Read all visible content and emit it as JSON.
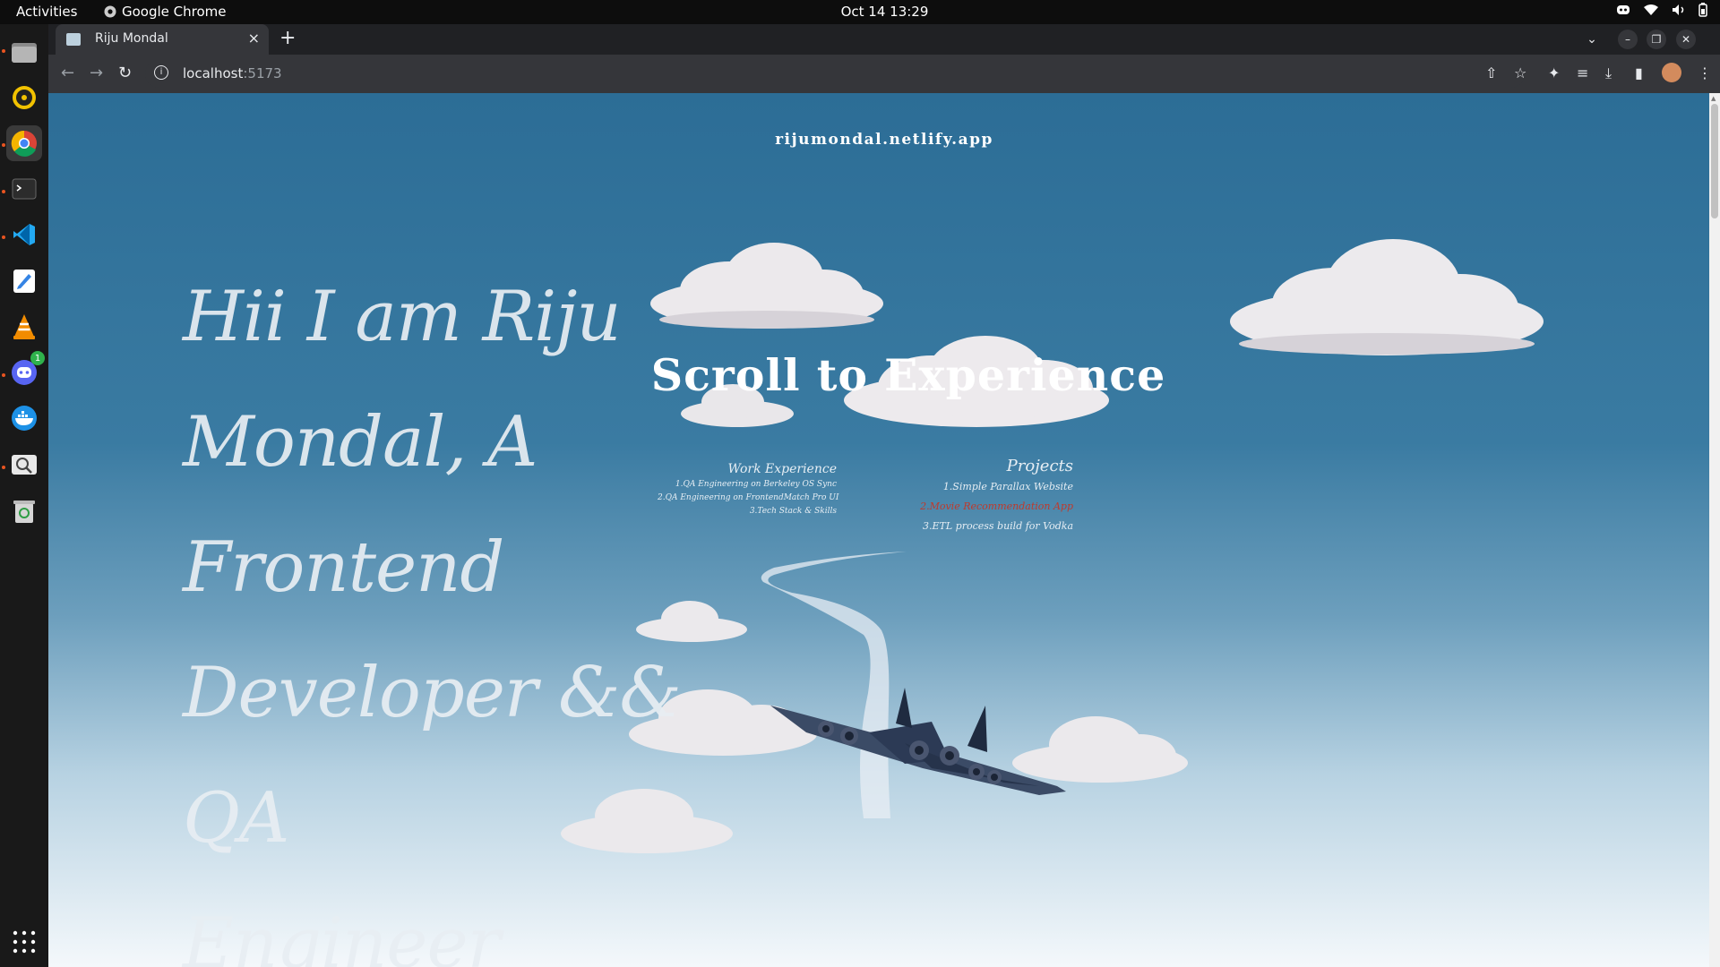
{
  "system": {
    "activities": "Activities",
    "app_name": "Google Chrome",
    "clock": "Oct 14  13:29"
  },
  "dock": {
    "items": [
      "files-icon",
      "rhythmbox-icon",
      "chrome-icon",
      "terminal-icon",
      "vscode-icon",
      "text-editor-icon",
      "vlc-icon",
      "discord-icon",
      "docker-icon",
      "image-viewer-icon",
      "trash-icon"
    ],
    "discord_badge": "1"
  },
  "browser": {
    "tab_title": "Riju Mondal",
    "url_host": "localhost",
    "url_port": ":5173"
  },
  "page": {
    "site_title": "rijumondal.netlify.app",
    "hero_lines": [
      "Hii I am Riju",
      "Mondal, A Frontend",
      "Developer && QA",
      "Engineer"
    ],
    "scroll_text": "Scroll to Experience",
    "work": {
      "heading": "Work Experience",
      "items": [
        "1.QA Engineering on Berkeley OS Sync",
        "2.QA Engineering on FrontendMatch Pro UI",
        "3.Tech Stack & Skills"
      ]
    },
    "projects": {
      "heading": "Projects",
      "items": [
        "1.Simple Parallax Website",
        "2.Movie Recommendation App",
        "3.ETL process build for Vodka"
      ],
      "highlight_index": 1,
      "highlight_color": "#c0392b"
    }
  },
  "colors": {
    "sky_top": "#2c6d96",
    "sky_bottom": "#f4f8fb",
    "accent": "#e95420"
  }
}
